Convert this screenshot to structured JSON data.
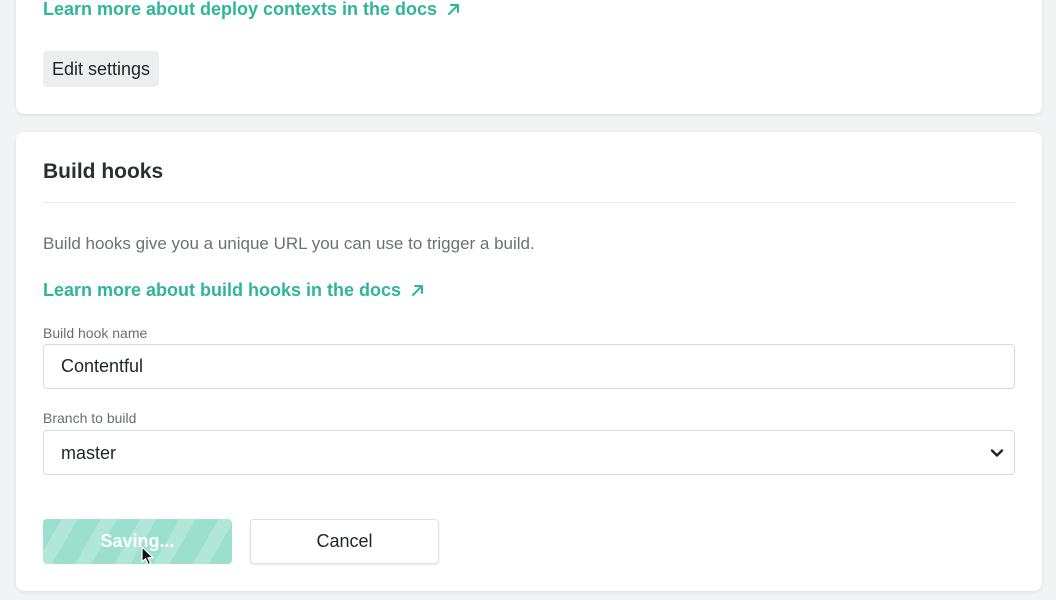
{
  "deploy_contexts": {
    "docs_link": "Learn more about deploy contexts in the docs",
    "edit_button": "Edit settings"
  },
  "build_hooks": {
    "title": "Build hooks",
    "description": "Build hooks give you a unique URL you can use to trigger a build.",
    "docs_link": "Learn more about build hooks in the docs",
    "name_field": {
      "label": "Build hook name",
      "value": "Contentful"
    },
    "branch_field": {
      "label": "Branch to build",
      "value": "master"
    },
    "save_button": "Saving...",
    "cancel_button": "Cancel"
  },
  "colors": {
    "link": "#2fb597",
    "saving_button": "#9be0cc",
    "background": "#f2f3f4"
  },
  "icons": {
    "external_link": "arrow-up-right-icon",
    "select": "chevron-down-icon",
    "cursor": "mouse-pointer-icon"
  }
}
